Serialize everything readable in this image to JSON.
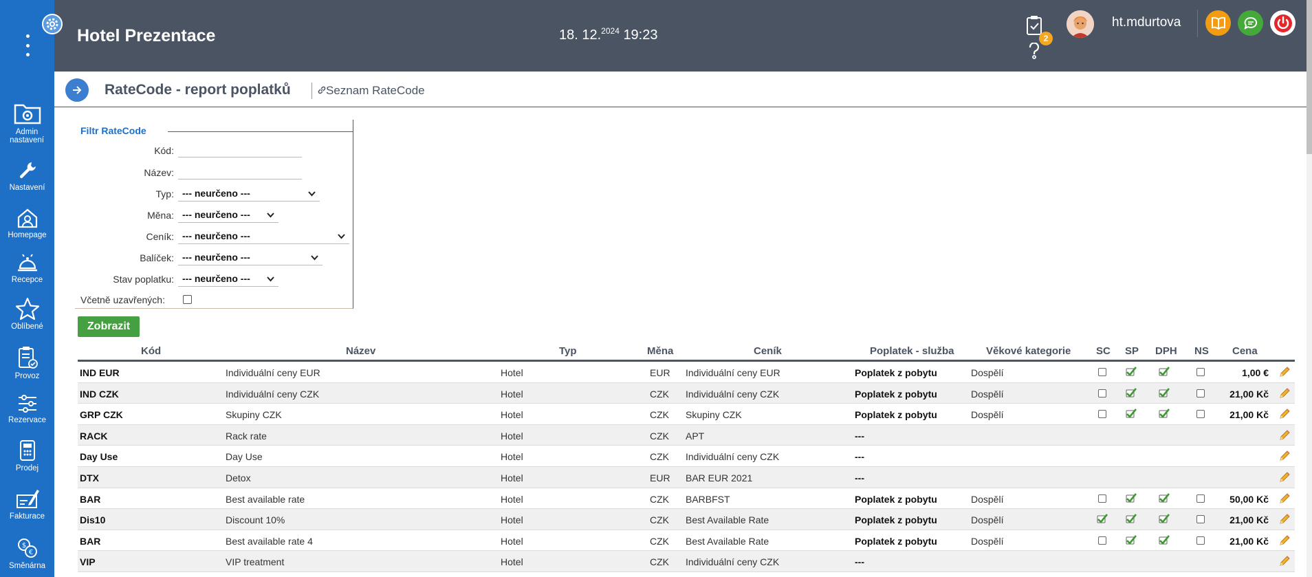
{
  "sidebar": {
    "items": [
      {
        "label": "Admin nastavení",
        "icon": "folder-gear-icon"
      },
      {
        "label": "Nastavení",
        "icon": "wrench-icon"
      },
      {
        "label": "Homepage",
        "icon": "home-icon"
      },
      {
        "label": "Recepce",
        "icon": "bell-icon"
      },
      {
        "label": "Oblíbené",
        "icon": "star-icon"
      },
      {
        "label": "Provoz",
        "icon": "clipboard-check-icon"
      },
      {
        "label": "Rezervace",
        "icon": "sliders-icon"
      },
      {
        "label": "Prodej",
        "icon": "calculator-icon"
      },
      {
        "label": "Fakturace",
        "icon": "invoice-icon"
      },
      {
        "label": "Směnárna",
        "icon": "exchange-icon"
      }
    ]
  },
  "header": {
    "hotel_name": "Hotel Prezentace",
    "date_main": "18. 12.",
    "date_year": "2024",
    "time": "19:23",
    "tasks_badge": "2",
    "username": "ht.mdurtova"
  },
  "page": {
    "title": "RateCode - report poplatků",
    "link_label": "Seznam RateCode"
  },
  "filter": {
    "legend": "Filtr RateCode",
    "kod_label": "Kód:",
    "kod_value": "",
    "nazev_label": "Název:",
    "nazev_value": "",
    "typ_label": "Typ:",
    "typ_value": "--- neurčeno ---",
    "mena_label": "Měna:",
    "mena_value": "--- neurčeno ---",
    "cenik_label": "Ceník:",
    "cenik_value": "--- neurčeno ---",
    "balicek_label": "Balíček:",
    "balicek_value": "--- neurčeno ---",
    "stav_label": "Stav poplatku:",
    "stav_value": "--- neurčeno ---",
    "uzavrene_label": "Včetně uzavřených:",
    "submit_label": "Zobrazit"
  },
  "table": {
    "headers": {
      "kod": "Kód",
      "nazev": "Název",
      "typ": "Typ",
      "mena": "Měna",
      "cenik": "Ceník",
      "poplatek": "Poplatek - služba",
      "vekove": "Věkové kategorie",
      "sc": "SC",
      "sp": "SP",
      "dph": "DPH",
      "ns": "NS",
      "cena": "Cena"
    },
    "rows": [
      {
        "kod": "IND EUR",
        "nazev": "Individuální ceny EUR",
        "typ": "Hotel",
        "mena": "EUR",
        "cenik": "Individuální ceny EUR",
        "poplatek": "Poplatek z pobytu",
        "vekove": "Dospělí",
        "sc": false,
        "sp": true,
        "dph": true,
        "ns": false,
        "cena": "1,00 €",
        "flags": true
      },
      {
        "kod": "IND CZK",
        "nazev": "Individuální ceny CZK",
        "typ": "Hotel",
        "mena": "CZK",
        "cenik": "Individuální ceny CZK",
        "poplatek": "Poplatek z pobytu",
        "vekove": "Dospělí",
        "sc": false,
        "sp": true,
        "dph": true,
        "ns": false,
        "cena": "21,00 Kč",
        "flags": true
      },
      {
        "kod": "GRP CZK",
        "nazev": "Skupiny CZK",
        "typ": "Hotel",
        "mena": "CZK",
        "cenik": "Skupiny CZK",
        "poplatek": "Poplatek z pobytu",
        "vekove": "Dospělí",
        "sc": false,
        "sp": true,
        "dph": true,
        "ns": false,
        "cena": "21,00 Kč",
        "flags": true
      },
      {
        "kod": "RACK",
        "nazev": "Rack rate",
        "typ": "Hotel",
        "mena": "CZK",
        "cenik": "APT",
        "poplatek": "---",
        "vekove": "",
        "cena": "",
        "flags": false
      },
      {
        "kod": "Day Use",
        "nazev": "Day Use",
        "typ": "Hotel",
        "mena": "CZK",
        "cenik": "Individuální ceny CZK",
        "poplatek": "---",
        "vekove": "",
        "cena": "",
        "flags": false
      },
      {
        "kod": "DTX",
        "nazev": "Detox",
        "typ": "Hotel",
        "mena": "EUR",
        "cenik": "BAR EUR 2021",
        "poplatek": "---",
        "vekove": "",
        "cena": "",
        "flags": false
      },
      {
        "kod": "BAR",
        "nazev": "Best available rate",
        "typ": "Hotel",
        "mena": "CZK",
        "cenik": "BARBFST",
        "poplatek": "Poplatek z pobytu",
        "vekove": "Dospělí",
        "sc": false,
        "sp": true,
        "dph": true,
        "ns": false,
        "cena": "50,00 Kč",
        "flags": true
      },
      {
        "kod": "Dis10",
        "nazev": "Discount 10%",
        "typ": "Hotel",
        "mena": "CZK",
        "cenik": "Best Available Rate",
        "poplatek": "Poplatek z pobytu",
        "vekove": "Dospělí",
        "sc": true,
        "sp": true,
        "dph": true,
        "ns": false,
        "cena": "21,00 Kč",
        "flags": true
      },
      {
        "kod": "BAR",
        "nazev": "Best available rate 4",
        "typ": "Hotel",
        "mena": "CZK",
        "cenik": "Best Available Rate",
        "poplatek": "Poplatek z pobytu",
        "vekove": "Dospělí",
        "sc": false,
        "sp": true,
        "dph": true,
        "ns": false,
        "cena": "21,00 Kč",
        "flags": true
      },
      {
        "kod": "VIP",
        "nazev": "VIP treatment",
        "typ": "Hotel",
        "mena": "CZK",
        "cenik": "Individuální ceny CZK",
        "poplatek": "---",
        "vekove": "",
        "cena": "",
        "flags": false
      }
    ]
  }
}
